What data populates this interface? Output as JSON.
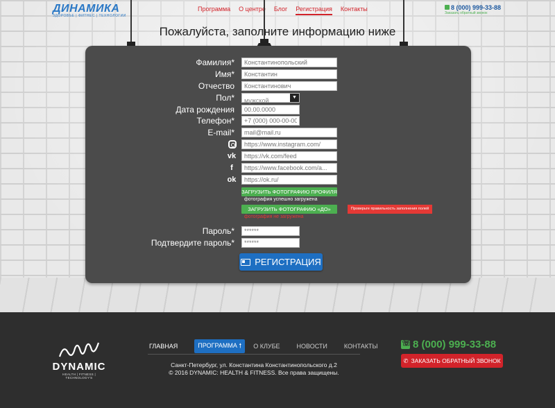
{
  "header": {
    "logo_text": "ДИНАМИКА",
    "logo_sub": "ЗДОРОВЬЕ | ФИТНЕС | ТЕХНОЛОГИИ",
    "nav": [
      "Программа",
      "О центре",
      "Блог",
      "Регистрация",
      "Контакты"
    ],
    "active_nav": "Регистрация",
    "phone": "8 (000) 999-33-88",
    "callback_link": "Заказать обратный звонок"
  },
  "page_title": "Пожалуйста, заполните информацию ниже",
  "form": {
    "surname": {
      "label": "Фамилия*",
      "placeholder": "Константинопольский"
    },
    "name": {
      "label": "Имя*",
      "placeholder": "Константин"
    },
    "patronymic": {
      "label": "Отчество",
      "placeholder": "Константинович"
    },
    "gender": {
      "label": "Пол*",
      "value": "мужской"
    },
    "birthdate": {
      "label": "Дата рождения",
      "placeholder": "00.00.0000"
    },
    "phone": {
      "label": "Телефон*",
      "placeholder": "+7 (000) 000-00-00"
    },
    "email": {
      "label": "E-mail*",
      "placeholder": "mail@mail.ru"
    },
    "instagram": {
      "placeholder": "https://www.instagram.com/"
    },
    "vk": {
      "placeholder": "https://vk.com/feed"
    },
    "facebook": {
      "placeholder": "https://www.facebook.com/a..."
    },
    "ok": {
      "placeholder": "https://ok.ru/"
    },
    "upload_profile": {
      "label": "ЗАГРУЗИТЬ ФОТОГРАФИЮ ПРОФИЛЯ",
      "status": "фотография успешно загружена"
    },
    "upload_before": {
      "label": "ЗАГРУЗИТЬ ФОТОГРАФИЮ «ДО»",
      "status": "фотография не загружена"
    },
    "error_message": "Проверьте правильность заполнения полей",
    "password": {
      "label": "Пароль*",
      "placeholder": "******"
    },
    "password_confirm": {
      "label": "Подтвердите пароль*",
      "placeholder": "******"
    },
    "submit": "РЕГИСТРАЦИЯ"
  },
  "footer": {
    "logo_name": "DYNAMIC",
    "logo_sub": "HEALTH | FITNESS | TECHNOLOGY'S",
    "nav": [
      "ГЛАВНАЯ",
      "ПРОГРАММА",
      "О КЛУБЕ",
      "НОВОСТИ",
      "КОНТАКТЫ"
    ],
    "address": "Санкт-Петербург, ул. Константина Константинопольского д.2",
    "copyright": "© 2016 DYNAMIC: HEALTH & FITNESS. Все права защищены.",
    "phone": "8 (000) 999-33-88",
    "callback_button": "ЗАКАЗАТЬ ОБРАТНЫЙ ЗВОНОК"
  },
  "colors": {
    "accent_red": "#d2232a",
    "accent_green": "#4caf50",
    "accent_blue": "#1e6fc2",
    "board": "#4b4b4b"
  }
}
